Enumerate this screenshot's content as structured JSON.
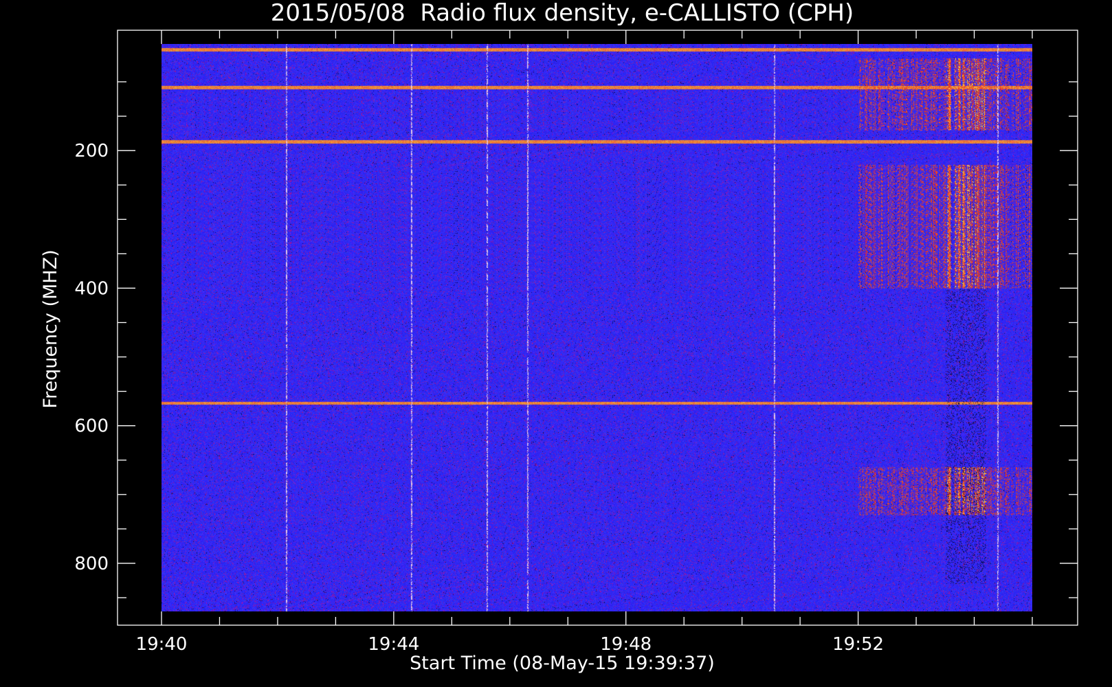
{
  "chart_data": {
    "type": "heatmap",
    "title": "2015/05/08  Radio flux density, e-CALLISTO (CPH)",
    "xlabel": "Start Time (08-May-15 19:39:37)",
    "ylabel": "Frequency (MHZ)",
    "x_ticks": [
      "19:40",
      "19:44",
      "19:48",
      "19:52"
    ],
    "x_tick_minutes": [
      0,
      4,
      8,
      12
    ],
    "x_range_minutes": [
      0,
      15
    ],
    "y_ticks": [
      200,
      400,
      600,
      800
    ],
    "y_range_mhz": [
      45,
      870
    ],
    "y_inverted": true,
    "colors": {
      "background": "#1a12f5",
      "quiet": "#2a22ff",
      "burst_low": "#b01818",
      "burst_mid": "#ff3a10",
      "burst_high": "#ffe060",
      "axes": "#ffffff",
      "page": "#000000"
    },
    "features": {
      "rfi_lines_mhz": [
        53,
        108,
        187,
        567
      ],
      "burst_onset_minute": 12.0,
      "intense_burst_minutes": [
        13.5,
        14.2
      ],
      "burst_bands_mhz": [
        [
          65,
          170
        ],
        [
          220,
          400
        ],
        [
          660,
          730
        ]
      ]
    }
  }
}
